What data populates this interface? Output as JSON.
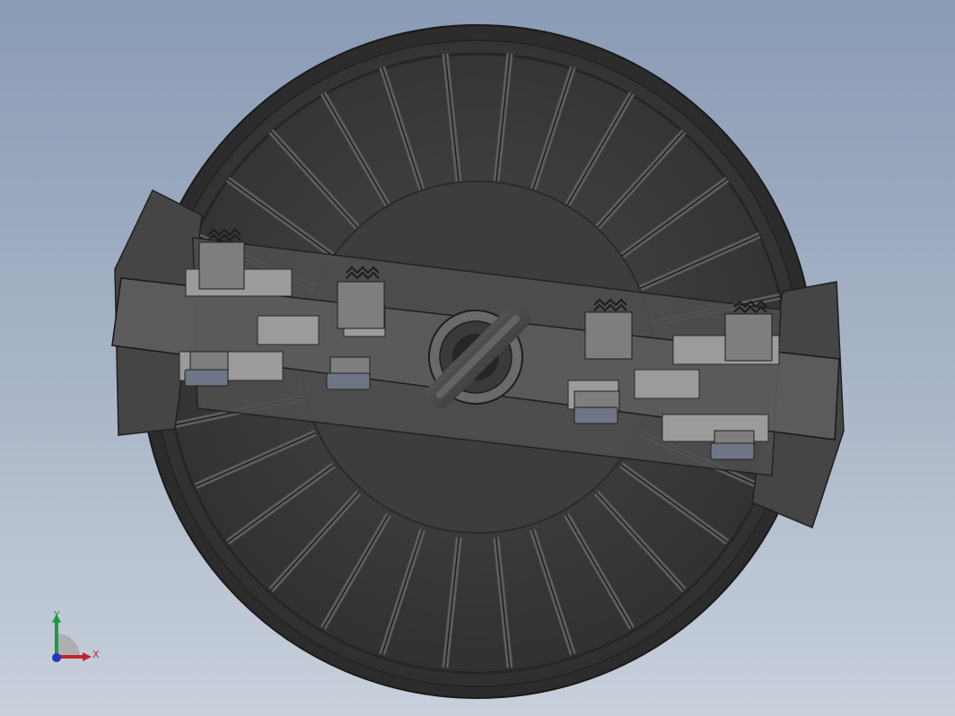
{
  "viewport": {
    "background_top": "#8a9bb5",
    "background_bottom": "#c8d0dc"
  },
  "model": {
    "description_icon": "reel-assembly-model",
    "body_color": "#3a3a3a",
    "plate_color": "#5a5a5a",
    "hardware_color": "#9a9a9a",
    "spoke_count": 30
  },
  "triad": {
    "y_label": "Y",
    "x_label": "X",
    "y_color": "#1f9a3a",
    "x_color": "#c0272d",
    "z_color": "#2436b8"
  }
}
